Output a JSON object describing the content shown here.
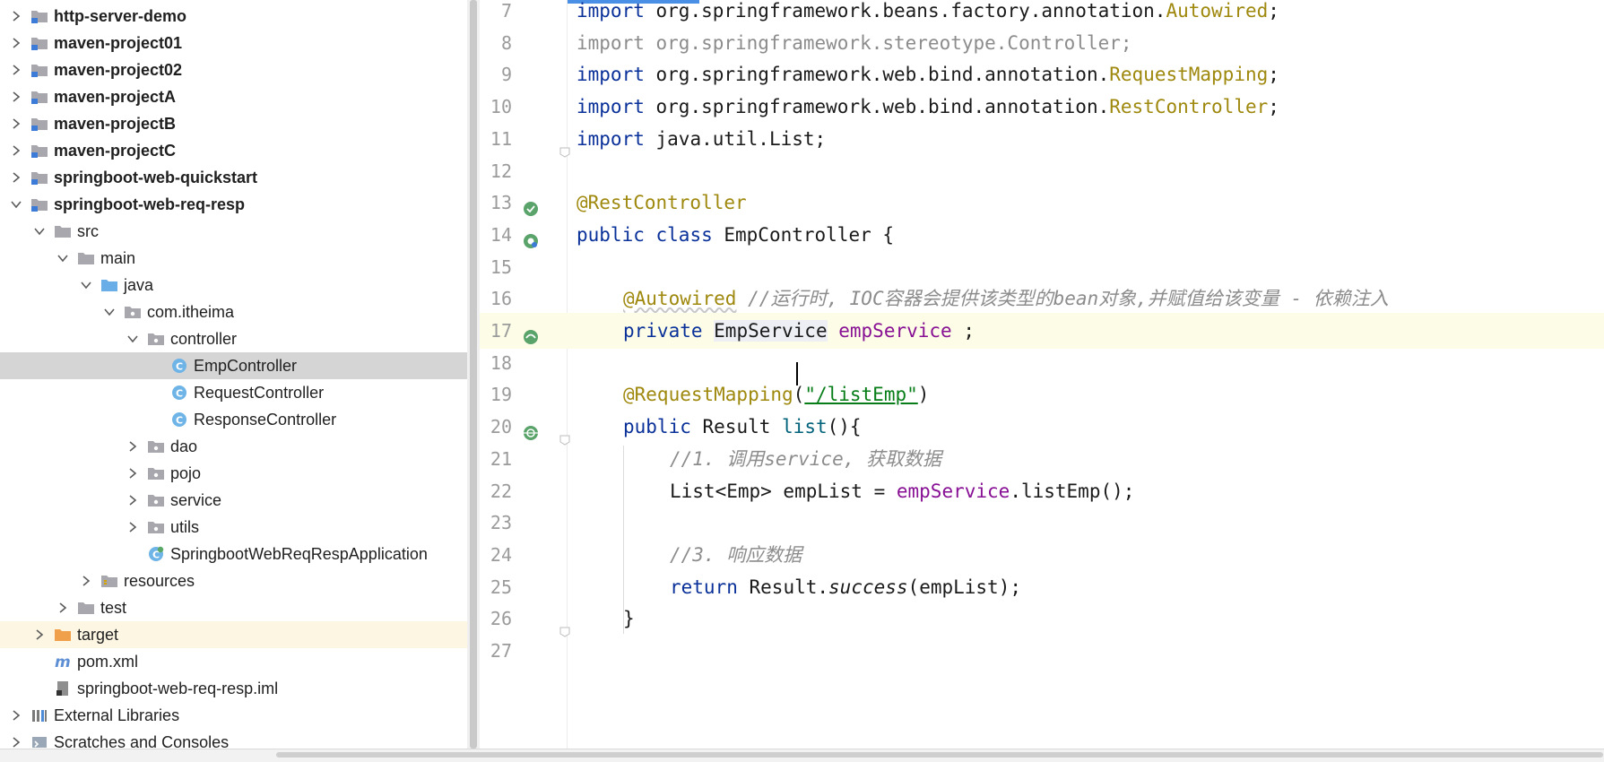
{
  "project_tree": {
    "items": [
      {
        "label": "http-server-demo",
        "expand": "collapsed",
        "icon": "module-folder-icon",
        "bold": true
      },
      {
        "label": "maven-project01",
        "expand": "collapsed",
        "icon": "module-folder-icon",
        "bold": true
      },
      {
        "label": "maven-project02",
        "expand": "collapsed",
        "icon": "module-folder-icon",
        "bold": true
      },
      {
        "label": "maven-projectA",
        "expand": "collapsed",
        "icon": "module-folder-icon",
        "bold": true
      },
      {
        "label": "maven-projectB",
        "expand": "collapsed",
        "icon": "module-folder-icon",
        "bold": true
      },
      {
        "label": "maven-projectC",
        "expand": "collapsed",
        "icon": "module-folder-icon",
        "bold": true
      },
      {
        "label": "springboot-web-quickstart",
        "expand": "collapsed",
        "icon": "module-folder-icon",
        "bold": true
      },
      {
        "label": "springboot-web-req-resp",
        "expand": "expanded",
        "icon": "module-folder-icon",
        "bold": true
      },
      {
        "label": "src",
        "expand": "expanded",
        "icon": "folder-icon",
        "depth": 1
      },
      {
        "label": "main",
        "expand": "expanded",
        "icon": "folder-icon",
        "depth": 2
      },
      {
        "label": "java",
        "expand": "expanded",
        "icon": "source-folder-icon",
        "depth": 3
      },
      {
        "label": "com.itheima",
        "expand": "expanded",
        "icon": "package-icon",
        "depth": 4
      },
      {
        "label": "controller",
        "expand": "expanded",
        "icon": "package-icon",
        "depth": 5
      },
      {
        "label": "EmpController",
        "expand": "none",
        "icon": "class-icon",
        "depth": 6,
        "selected": true
      },
      {
        "label": "RequestController",
        "expand": "none",
        "icon": "class-icon",
        "depth": 6
      },
      {
        "label": "ResponseController",
        "expand": "none",
        "icon": "class-icon",
        "depth": 6
      },
      {
        "label": "dao",
        "expand": "collapsed",
        "icon": "package-icon",
        "depth": 5
      },
      {
        "label": "pojo",
        "expand": "collapsed",
        "icon": "package-icon",
        "depth": 5
      },
      {
        "label": "service",
        "expand": "collapsed",
        "icon": "package-icon",
        "depth": 5
      },
      {
        "label": "utils",
        "expand": "collapsed",
        "icon": "package-icon",
        "depth": 5
      },
      {
        "label": "SpringbootWebReqRespApplication",
        "expand": "none",
        "icon": "springboot-app-class-icon",
        "depth": 5
      },
      {
        "label": "resources",
        "expand": "collapsed",
        "icon": "resources-folder-icon",
        "depth": 3
      },
      {
        "label": "test",
        "expand": "collapsed",
        "icon": "folder-icon",
        "depth": 2
      },
      {
        "label": "target",
        "expand": "collapsed",
        "icon": "excluded-folder-icon",
        "depth": 1,
        "excluded": true
      },
      {
        "label": "pom.xml",
        "expand": "none",
        "icon": "maven-file-icon",
        "depth": 1
      },
      {
        "label": "springboot-web-req-resp.iml",
        "expand": "none",
        "icon": "iml-file-icon",
        "depth": 1
      },
      {
        "label": "External Libraries",
        "expand": "collapsed",
        "icon": "libraries-icon"
      },
      {
        "label": "Scratches and Consoles",
        "expand": "collapsed",
        "icon": "scratches-icon"
      }
    ]
  },
  "editor": {
    "line_numbers": [
      "7",
      "8",
      "9",
      "10",
      "11",
      "12",
      "13",
      "14",
      "15",
      "16",
      "17",
      "18",
      "19",
      "20",
      "21",
      "22",
      "23",
      "24",
      "25",
      "26",
      "27"
    ],
    "current_line": "17",
    "gutter_icons": {
      "13": "bean-icon",
      "14": "bean-class-icon",
      "17": "autowired-bean-icon",
      "20": "web-endpoint-icon"
    },
    "fold_lines": [
      "11",
      "20",
      "26"
    ],
    "code": {
      "l7": [
        "import ",
        "org.springframework.beans.factory.annotation.",
        "Autowired",
        ";"
      ],
      "l8": [
        "import org.springframework.stereotype.Controller;"
      ],
      "l9": [
        "import ",
        "org.springframework.web.bind.annotation.",
        "RequestMapping",
        ";"
      ],
      "l10": [
        "import ",
        "org.springframework.web.bind.annotation.",
        "RestController",
        ";"
      ],
      "l11": [
        "import ",
        "java.util.List;"
      ],
      "l13": [
        "@RestController"
      ],
      "l14": [
        "public ",
        "class ",
        "EmpController {"
      ],
      "l16": [
        "@Autowired",
        " //运行时, IOC容器会提供该类型的bean对象,并赋值给该变量 - 依赖注入"
      ],
      "l17": [
        "private ",
        "EmpService",
        " ",
        "empService",
        " ;"
      ],
      "l19": [
        "@RequestMapping",
        "(",
        "\"/listEmp\"",
        ")"
      ],
      "l20": [
        "public ",
        "Result ",
        "list",
        "(){"
      ],
      "l21": [
        "//1. 调用service, 获取数据"
      ],
      "l22": [
        "List<Emp> empList = ",
        "empService",
        ".listEmp();"
      ],
      "l24": [
        "//3. 响应数据"
      ],
      "l25": [
        "return ",
        "Result.",
        "success",
        "(empList);"
      ],
      "l26": [
        "}"
      ]
    }
  },
  "colors": {
    "keyword": "#0a3199",
    "annotation": "#9e880d",
    "field": "#871094",
    "string": "#067d17",
    "comment": "#8c8c8c",
    "selection": "#d5d5d5",
    "current_line": "#fdfce6"
  }
}
